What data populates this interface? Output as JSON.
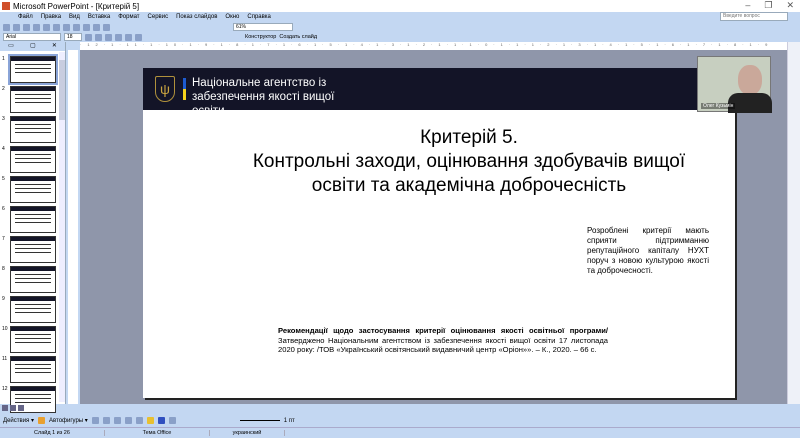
{
  "window": {
    "title": "Microsoft PowerPoint - [Критерій 5]",
    "minimize": "–",
    "restore": "❐",
    "close": "✕"
  },
  "menu": [
    "Файл",
    "Правка",
    "Вид",
    "Вставка",
    "Формат",
    "Сервис",
    "Показ слайдов",
    "Окно",
    "Справка"
  ],
  "help_placeholder": "Введите вопрос",
  "toolbar": {
    "zoom": "61%",
    "font": "Arial",
    "font_size": "18",
    "design": "Конструктор",
    "new_slide": "Создать слайд"
  },
  "panel_tabs": [
    "▭",
    "▢",
    "✕"
  ],
  "thumbnails": [
    "1",
    "2",
    "3",
    "4",
    "5",
    "6",
    "7",
    "8",
    "9",
    "10",
    "11",
    "12"
  ],
  "slide": {
    "org": "Національне агентство із забезпечення якості вищої освіти",
    "title_line1": "Критерій 5.",
    "title_line2": "Контрольні заходи, оцінювання здобувачів вищої",
    "title_line3": "освіти та академічна доброчесність",
    "side_note": "Розроблені критерії мають сприяти підтримманню репутаційного капіталу НУХТ поруч з новою культурою якості та доброчесності.",
    "ref_bold": "Рекомендації щодо застосування критерії оцінювання якості освітньої програми/",
    "ref_text": " Затверджено Національним агентством із забезпечення якості вищої освіти 17 листопада 2020 року: /ТОВ «Український освітянський видавничий центр «Оріон»». – К., 2020. – 66 с."
  },
  "webcam": {
    "name": "Олег Кузьмін"
  },
  "drawing": {
    "actions": "Действия ▾",
    "autoshapes": "Автофигуры ▾",
    "line_width": "1 пт"
  },
  "status": {
    "slide": "Слайд 1 из 26",
    "theme": "Тема Office",
    "language": "украинский"
  }
}
